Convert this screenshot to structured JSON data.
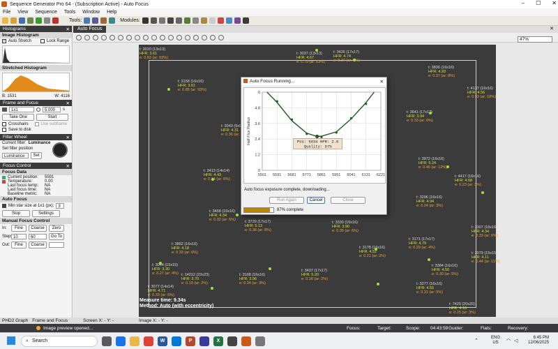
{
  "window": {
    "title": "Sequence Generator Pro 64 - (Subscription Active) - Auto Focus"
  },
  "menu": [
    "File",
    "View",
    "Sequence",
    "Tools",
    "Window",
    "Help"
  ],
  "toolbar": {
    "tools_label": "Tools:",
    "modules_label": "Modules:"
  },
  "left": {
    "histograms": {
      "header": "Histograms",
      "image_histogram": "Image Histogram",
      "auto_stretch": "Auto Stretch",
      "lock_range": "Lock Range",
      "stretched_histogram": "Stretched Histogram",
      "b_label": "B: 1531",
      "w_label": "W:  4116"
    },
    "frame_focus": {
      "header": "Frame and Focus",
      "binning": "1x1",
      "exposure": "5.000",
      "exposure_unit": "s",
      "take_one": "Take One",
      "start": "Start",
      "crosshairs": "Crosshairs",
      "use_subframe": "Use subframe",
      "save_to_disk": "Save to disk"
    },
    "filter_wheel": {
      "header": "Filter Wheel",
      "current_filter_label": "Current filter:",
      "current_filter": "Luminance",
      "set_filter_label": "Set filter position",
      "set_filter_value": "Luminance",
      "set_button": "Set"
    },
    "focus_control": {
      "header": "Focus Control",
      "focus_data": "Focus Data",
      "rows": [
        {
          "label": "Current position:",
          "value": "5591"
        },
        {
          "label": "Temperature:",
          "value": "0.00"
        },
        {
          "label": "Last focus temp:",
          "value": "NA"
        },
        {
          "label": "Last focus time:",
          "value": "NA"
        },
        {
          "label": "Baseline metric:",
          "value": "NA"
        }
      ],
      "auto_focus": "Auto Focus",
      "min_star_size": "Min star size at 1x1 (px):",
      "min_star_value": "3",
      "stop": "Stop",
      "settings": "Settings",
      "manual": "Manual Focus Control",
      "in_label": "In:",
      "out_label": "Out:",
      "steps_label": "Steps:",
      "fine": "Fine",
      "coarse": "Coarse",
      "zero": "Zero",
      "steps_fine": "10",
      "steps_coarse": "60",
      "goto": "Go To"
    }
  },
  "main": {
    "tab": "Auto Focus",
    "zoom": "47%",
    "measure_time": "Measure time: 9.34s",
    "method": "Method: Auto (with eccentricity)"
  },
  "stars": [
    {
      "t": "t: 3037 (13x13)",
      "h": "HFR: 4.67",
      "e": "e: 0.79 (ar: 63%)"
    },
    {
      "t": "t: 3426 (17x17)",
      "h": "HFR: 4.74",
      "e": "e: 0.37 (ar: 7%)"
    },
    {
      "t": "t: 3158 (16x16)",
      "h": "HFR: 3.61",
      "e": "e: 0.85 (ar: 93%)"
    },
    {
      "t": "t: 3020 (13x13)",
      "h": "HFR: 3.61",
      "e": "e: 0.83 (ar: 93%)"
    },
    {
      "t": "t: 3043 (9x9)",
      "h": "HFR: 4.31",
      "e": "e: 0.36 (ar: 7%)"
    },
    {
      "t": "t: 3413 (14x14)",
      "h": "HFR: 4.43",
      "e": "e: 0.34 (ar: 6%)"
    },
    {
      "t": "t: 3468 (16x16)",
      "h": "HFR: 4.34",
      "e": "e: 0.32 (ar: 6%)"
    },
    {
      "t": "t: 3862 (16x16)",
      "h": "HFR: 4.18",
      "e": "e: 0.33 (ar: 6%)"
    },
    {
      "t": "t: 3044 (15x15)",
      "h": "HFR: 3.30",
      "e": "e: 0.27 (ar: 4%)"
    },
    {
      "t": "t: 14012 (23x23)",
      "h": "HFR: 3.70",
      "e": "e: 0.19 (ar: 2%)"
    },
    {
      "t": "t: 3077 (14x14)",
      "h": "HFR: 4.71",
      "e": "e: 0.33 (ar: 6%)"
    },
    {
      "t": "t: 3729 (17x17)",
      "h": "HFR: 5.13",
      "e": "e: 0.38 (ar: 8%)"
    },
    {
      "t": "t: 3168 (16x16)",
      "h": "HFR: 3.96",
      "e": "e: 0.24 (ar: 3%)"
    },
    {
      "t": "t: 3437 (17x17)",
      "h": "HFR: 5.20",
      "e": "e: 0.18 (ar: 2%)"
    },
    {
      "t": "t: 3330 (16x16)",
      "h": "HFR: 3.90",
      "e": "e: 0.35 (ar: 6%)"
    },
    {
      "t": "t: 3178 (16x16)",
      "h": "HFR: 4.52",
      "e": "e: 0.21 (ar: 2%)"
    },
    {
      "t": "t: 3171 (17x17)",
      "h": "HFR: 4.79",
      "e": "e: 0.29 (ar: 4%)"
    },
    {
      "t": "t: 3641 (17x17)",
      "h": "HFR: 3.94",
      "e": "e: 0.33 (ar: 6%)"
    },
    {
      "t": "t: 3972 (16x16)",
      "h": "HFR: 5.24",
      "e": "e: 0.46 (ar: 12%)"
    },
    {
      "t": "t: 4417 (16x16)",
      "h": "HFR: 4.68",
      "e": "e: 0.23 (ar: 3%)"
    },
    {
      "t": "t: 3296 (16x16)",
      "h": "HFR: 4.94",
      "e": "e: 0.24 (ar: 3%)"
    },
    {
      "t": "t: 3307 (16x16)",
      "h": "HFR: 4.34",
      "e": "e: 0.33 (ar: 6%)"
    },
    {
      "t": "t: 3079 (15x15)",
      "h": "HFR: 4.11",
      "e": "e: 0.44 (ar: 11%)"
    },
    {
      "t": "t: 4137 (16x16)",
      "h": "HFR: 4.56",
      "e": "e: 0.53 (ar: 18%)"
    },
    {
      "t": "t: 3384 (16x16)",
      "h": "HFR: 4.50",
      "e": "e: 0.30 (ar: 5%)"
    },
    {
      "t": "t: 3277 (16x16)",
      "h": "HFR: 4.55",
      "e": "e: 0.31 (ar: 5%)"
    },
    {
      "t": "t: 3806 (16x16)",
      "h": "HFR: 4.93",
      "e": "e: 0.37 (ar: 8%)"
    },
    {
      "t": "t: 7429 (20x20)",
      "h": "HFR: 4.16",
      "e": "e: 0.25 (ar: 3%)"
    }
  ],
  "dialog": {
    "title": "Auto Focus Running...",
    "ylabel": "Half Flux Radius",
    "pos_label": "Pos: 5834  HFR: 2.6",
    "quality_label": "Quality: 97%",
    "status": "Auto focus exposure complete, downloading...",
    "run_again": "Run Again",
    "cancel": "Cancel",
    "close": "Close",
    "progress_text": "87% complete",
    "progress": 0.87
  },
  "chart_data": {
    "type": "line",
    "title": "",
    "xlabel": "",
    "ylabel": "Half Flux Radius",
    "xticks": [
      "5501",
      "5591",
      "5681",
      "5771",
      "5861",
      "5951",
      "6041",
      "6131",
      "6221"
    ],
    "yticks": [
      "0",
      "1.2",
      "2.4",
      "3.6",
      "4.8",
      "6"
    ],
    "xlim": [
      5501,
      6221
    ],
    "ylim": [
      0,
      6
    ],
    "series": [
      {
        "type": "points",
        "x": [
          5591,
          5681,
          5771,
          5861,
          5951,
          6041,
          6131
        ],
        "y": [
          5.3,
          3.9,
          2.8,
          2.55,
          2.9,
          4.0,
          5.1
        ]
      },
      {
        "type": "fit",
        "x": [
          5530,
          5591,
          5681,
          5771,
          5834,
          5861,
          5951,
          6041,
          6131,
          6180
        ],
        "y": [
          6.0,
          5.2,
          3.8,
          2.85,
          2.6,
          2.62,
          2.95,
          3.95,
          5.2,
          6.0
        ]
      }
    ],
    "best_focus": {
      "x": 5834,
      "y": 2.6
    },
    "grid": true
  },
  "bottom_tabs": [
    "PHD2 Graph",
    "Frame and Focus"
  ],
  "coords": {
    "screen": "Screen X: - Y: -",
    "image": "Image X: - Y: -"
  },
  "status": {
    "message": "Image preview opened...",
    "focus": "Focus:",
    "target": "Target:",
    "scope": "Scope:",
    "time": "04:43:59",
    "guider": "Guider:",
    "flats": "Flats:",
    "recovery": "Recovery:"
  },
  "taskbar": {
    "search": "Search",
    "lang1": "ENG",
    "lang2": "US",
    "clock_time": "6:45 PM",
    "clock_date": "12/06/2025"
  }
}
